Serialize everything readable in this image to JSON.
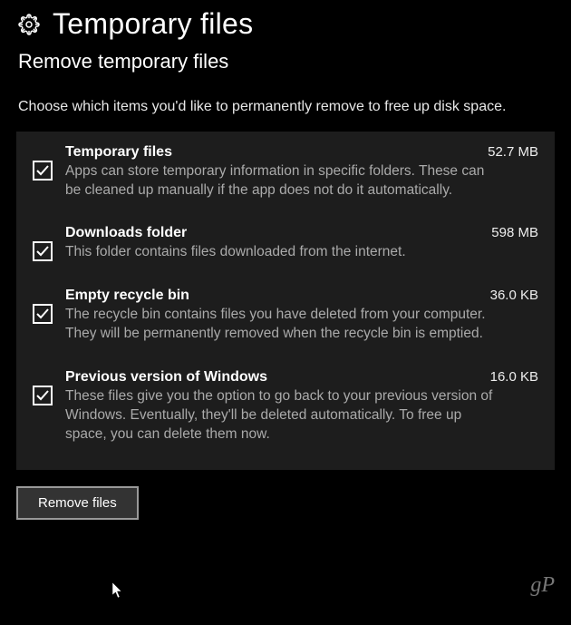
{
  "header": {
    "title": "Temporary files",
    "subtitle": "Remove temporary files"
  },
  "instruction": "Choose which items you'd like to permanently remove to free up disk space.",
  "items": [
    {
      "title": "Temporary files",
      "size": "52.7 MB",
      "desc": "Apps can store temporary information in specific folders. These can be cleaned up manually if the app does not do it automatically.",
      "checked": true
    },
    {
      "title": "Downloads folder",
      "size": "598 MB",
      "desc": "This folder contains files downloaded from the internet.",
      "checked": true
    },
    {
      "title": "Empty recycle bin",
      "size": "36.0 KB",
      "desc": "The recycle bin contains files you have deleted from your computer. They will be permanently removed when the recycle bin is emptied.",
      "checked": true
    },
    {
      "title": "Previous version of Windows",
      "size": "16.0 KB",
      "desc": "These files give you the option to go back to your previous version of Windows. Eventually, they'll be deleted automatically. To free up space, you can delete them now.",
      "checked": true
    }
  ],
  "removeButton": "Remove files",
  "watermark": "gP"
}
